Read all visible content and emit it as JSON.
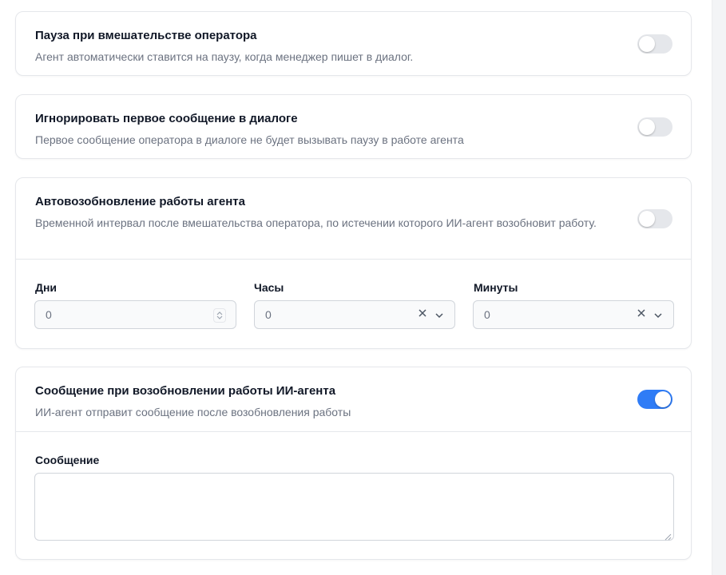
{
  "settings": [
    {
      "title": "Пауза при вмешательстве оператора",
      "description": "Агент автоматически ставится на паузу, когда менеджер пишет в диалог.",
      "enabled": false
    },
    {
      "title": "Игнорировать первое сообщение в диалоге",
      "description": "Первое сообщение оператора в диалоге не будет вызывать паузу в работе агента",
      "enabled": false
    },
    {
      "title": "Автовозобновление работы агента",
      "description": "Временной интервал после вмешательства оператора, по истечении которого ИИ-агент возобновит работу.",
      "enabled": false,
      "fields": {
        "days": {
          "label": "Дни",
          "value": "0"
        },
        "hours": {
          "label": "Часы",
          "value": "0"
        },
        "minutes": {
          "label": "Минуты",
          "value": "0"
        }
      }
    },
    {
      "title": "Сообщение при возобновлении работы ИИ-агента",
      "description": "ИИ-агент отправит сообщение после возобновления работы",
      "enabled": true,
      "message_label": "Сообщение",
      "message_value": ""
    }
  ],
  "colors": {
    "accent": "#2f7cf6",
    "toggle_off": "#e5e7eb",
    "border": "#e5e7eb"
  },
  "icons": {
    "stepper": "stepper-icon",
    "clear": "clear-icon",
    "dropdown": "chevron-down-icon",
    "resize": "resize-handle-icon"
  }
}
